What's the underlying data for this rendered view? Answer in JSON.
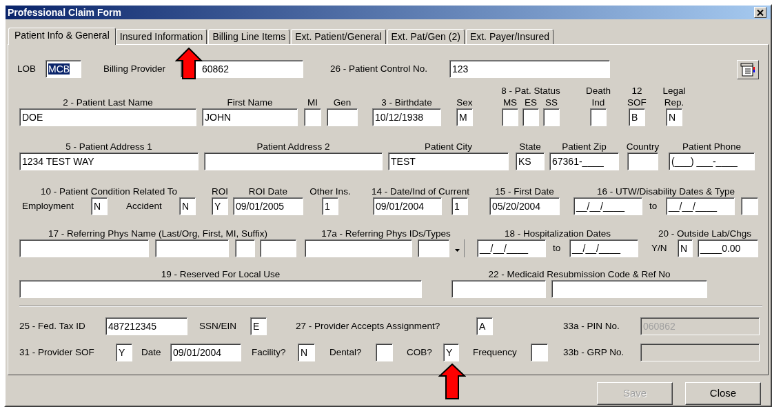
{
  "window": {
    "title": "Professional Claim Form"
  },
  "tabs": [
    {
      "label": "Patient Info & General",
      "selected": true
    },
    {
      "label": "Insured Information",
      "selected": false
    },
    {
      "label": "Billing Line Items",
      "selected": false
    },
    {
      "label": "Ext. Patient/General",
      "selected": false
    },
    {
      "label": "Ext. Pat/Gen (2)",
      "selected": false
    },
    {
      "label": "Ext. Payer/Insured",
      "selected": false
    }
  ],
  "rows": [
    {
      "groups": [
        {
          "kind": "inline",
          "label": "LOB",
          "fields": [
            {
              "value": "MCB",
              "text_selected": true
            }
          ]
        },
        {
          "kind": "inline",
          "label": "Billing Provider",
          "fields": [
            {
              "value": "60862"
            }
          ]
        },
        {
          "kind": "inline",
          "label": "26 - Patient Control No.",
          "fields": [
            {
              "value": "123"
            }
          ]
        }
      ]
    },
    {
      "groups": [
        {
          "kind": "stacked",
          "label": "2 - Patient Last Name",
          "fields": [
            {
              "value": "DOE"
            }
          ]
        },
        {
          "kind": "stacked",
          "label": "First Name",
          "fields": [
            {
              "value": "JOHN"
            }
          ]
        },
        {
          "kind": "stacked",
          "label": "MI",
          "fields": [
            {
              "kind": "text"
            }
          ]
        },
        {
          "kind": "stacked",
          "label": "Gen",
          "fields": [
            {
              "kind": "text"
            }
          ]
        },
        {
          "kind": "stacked",
          "label": "3 - Birthdate",
          "fields": [
            {
              "value": "10/12/1938"
            }
          ]
        },
        {
          "kind": "stacked",
          "label": "Sex",
          "fields": [
            {
              "value": "M"
            }
          ]
        },
        {
          "kind": "stacked",
          "label": "8 - Pat. Status",
          "fields": [
            {
              "sublabel": "MS"
            },
            {
              "sublabel": "ES"
            },
            {
              "sublabel": "SS"
            }
          ]
        },
        {
          "kind": "stacked",
          "label": "Death Ind",
          "fields": [
            {
              "kind": "text"
            }
          ]
        },
        {
          "kind": "stacked",
          "label": "12 SOF",
          "fields": [
            {
              "value": "B"
            }
          ]
        },
        {
          "kind": "stacked",
          "label": "Legal Rep.",
          "fields": [
            {
              "value": "N"
            }
          ]
        }
      ]
    },
    {
      "groups": [
        {
          "kind": "stacked",
          "label": "5 - Patient Address 1",
          "fields": [
            {
              "value": "1234 TEST WAY"
            }
          ]
        },
        {
          "kind": "stacked",
          "label": "Patient Address 2",
          "fields": [
            {
              "kind": "text"
            }
          ]
        },
        {
          "kind": "stacked",
          "label": "Patient City",
          "fields": [
            {
              "value": "TEST"
            }
          ]
        },
        {
          "kind": "stacked",
          "label": "State",
          "fields": [
            {
              "value": "KS"
            }
          ]
        },
        {
          "kind": "stacked",
          "label": "Patient Zip",
          "fields": [
            {
              "value": "67361-____"
            }
          ]
        },
        {
          "kind": "stacked",
          "label": "Country",
          "fields": [
            {
              "kind": "text"
            }
          ]
        },
        {
          "kind": "stacked",
          "label": "Patient Phone",
          "fields": [
            {
              "value": "(___) ___-____"
            }
          ]
        }
      ]
    },
    {
      "groups": [
        {
          "kind": "stacked",
          "label": "10 - Patient Condition Related To",
          "fields": [
            {
              "prefix": "Employment",
              "value": "N"
            },
            {
              "prefix": "Accident",
              "value": "N"
            }
          ]
        },
        {
          "kind": "stacked",
          "label": "ROI",
          "fields": [
            {
              "value": "Y"
            }
          ]
        },
        {
          "kind": "stacked",
          "label": "ROI Date",
          "fields": [
            {
              "value": "09/01/2005"
            }
          ]
        },
        {
          "kind": "stacked",
          "label": "Other Ins.",
          "fields": [
            {
              "value": "1"
            }
          ]
        },
        {
          "kind": "stacked",
          "label": "14 - Date/Ind of Current",
          "fields": [
            {
              "value": "09/01/2004"
            },
            {
              "value": "1"
            }
          ]
        },
        {
          "kind": "stacked",
          "label": "15 - First Date",
          "fields": [
            {
              "value": "05/20/2004"
            }
          ]
        },
        {
          "kind": "stacked",
          "label": "16 - UTW/Disability Dates & Type",
          "fields": [
            {
              "value": "__/__/____"
            },
            {
              "prefix": "to",
              "value": "__/__/____"
            },
            {
              "kind": "text"
            }
          ]
        }
      ]
    },
    {
      "groups": [
        {
          "kind": "stacked",
          "label": "17 - Referring Phys Name (Last/Org, First, MI, Suffix)",
          "fields": [
            {
              "kind": "text"
            },
            {
              "kind": "text"
            },
            {
              "kind": "text"
            },
            {
              "kind": "text"
            }
          ]
        },
        {
          "kind": "stacked",
          "label": "17a - Referring Phys IDs/Types",
          "fields": [
            {
              "kind": "text"
            },
            {
              "kind": "dropdown"
            }
          ]
        },
        {
          "kind": "stacked",
          "label": "18 - Hospitalization Dates",
          "fields": [
            {
              "value": "__/__/____"
            },
            {
              "prefix": "to",
              "value": "__/__/____"
            }
          ]
        },
        {
          "kind": "stacked",
          "label": "20 - Outside Lab/Chgs",
          "fields": [
            {
              "prefix": "Y/N",
              "value": "N"
            },
            {
              "value": "____0.00"
            }
          ]
        }
      ]
    },
    {
      "groups": [
        {
          "kind": "stacked",
          "label": "19 - Reserved For Local Use",
          "fields": [
            {
              "kind": "text"
            }
          ]
        },
        {
          "kind": "stacked",
          "label": "22 - Medicaid Resubmission Code & Ref No",
          "fields": [
            {
              "kind": "text"
            },
            {
              "kind": "text"
            }
          ]
        }
      ]
    },
    {
      "groups": [
        {
          "kind": "inline",
          "label": "25 - Fed. Tax ID",
          "fields": [
            {
              "value": "487212345",
              "disabled": false
            }
          ]
        },
        {
          "kind": "inline",
          "label": "SSN/EIN",
          "fields": [
            {
              "value": "E",
              "disabled": false
            }
          ]
        },
        {
          "kind": "inline",
          "label": "27 - Provider Accepts Assignment?",
          "fields": [
            {
              "value": "A",
              "disabled": false
            }
          ]
        },
        {
          "kind": "inline",
          "label": "33a - PIN No.",
          "fields": [
            {
              "value": "060862",
              "disabled": true
            }
          ]
        }
      ]
    },
    {
      "groups": [
        {
          "kind": "inline",
          "label": "31 - Provider SOF",
          "fields": [
            {
              "value": "Y",
              "disabled": false
            }
          ]
        },
        {
          "kind": "inline",
          "label": "Date",
          "fields": [
            {
              "value": "09/01/2004",
              "disabled": false
            }
          ]
        },
        {
          "kind": "inline",
          "label": "Facility?",
          "fields": [
            {
              "value": "N",
              "disabled": false
            }
          ]
        },
        {
          "kind": "inline",
          "label": "Dental?",
          "fields": [
            {
              "disabled": false
            }
          ]
        },
        {
          "kind": "inline",
          "label": "COB?",
          "fields": [
            {
              "value": "Y",
              "disabled": false
            }
          ]
        },
        {
          "kind": "inline",
          "label": "Frequency",
          "fields": [
            {
              "disabled": false
            }
          ]
        },
        {
          "kind": "inline",
          "label": "33b - GRP No.",
          "fields": [
            {
              "disabled": true
            }
          ]
        }
      ]
    }
  ],
  "buttons": [
    {
      "label": "Save",
      "disabled": true
    },
    {
      "label": "Close",
      "disabled": false
    }
  ]
}
